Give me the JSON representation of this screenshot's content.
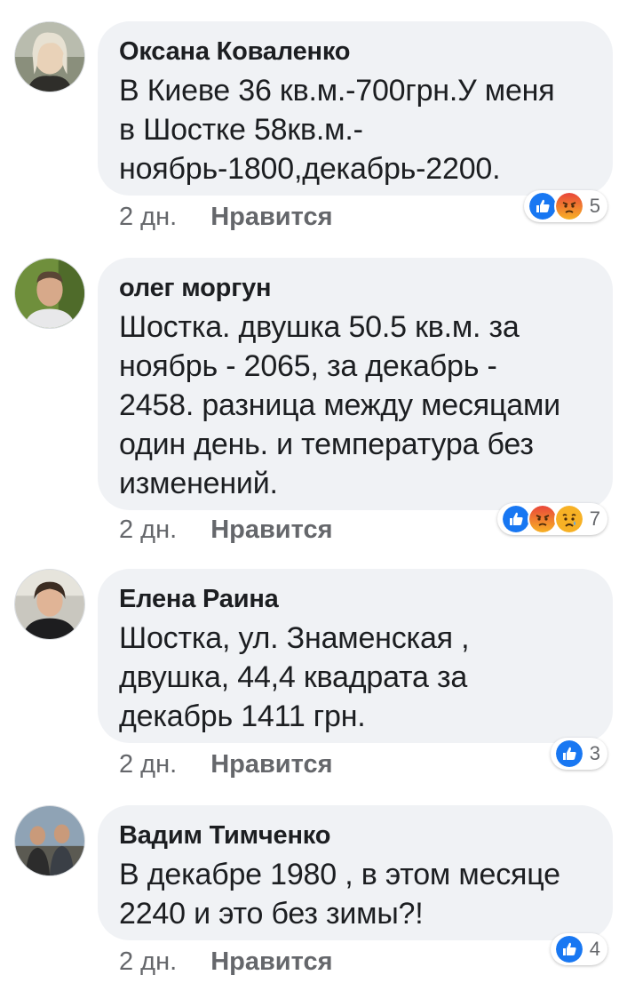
{
  "comments": [
    {
      "author": "Оксана Коваленко",
      "text_lines": [
        "В Киеве 36 кв.м.-700грн.У меня",
        "в Шостке 58кв.м.-",
        "ноябрь-1800,декабрь-2200."
      ],
      "time": "2 дн.",
      "like_label": "Нравится",
      "reactions": [
        "like-icon",
        "angry-icon"
      ],
      "reaction_count": "5"
    },
    {
      "author": "олег моргун",
      "text_lines": [
        "Шостка. двушка 50.5 кв.м. за",
        "ноябрь - 2065, за декабрь -",
        "2458. разница между месяцами",
        "один день. и температура без",
        "изменений."
      ],
      "time": "2 дн.",
      "like_label": "Нравится",
      "reactions": [
        "like-icon",
        "angry-icon",
        "sad-icon"
      ],
      "reaction_count": "7"
    },
    {
      "author": "Елена Раина",
      "text_lines": [
        "Шостка, ул. Знаменская ,",
        "двушка, 44,4 квадрата за",
        "декабрь 1411 грн."
      ],
      "time": "2 дн.",
      "like_label": "Нравится",
      "reactions": [
        "like-icon"
      ],
      "reaction_count": "3"
    },
    {
      "author": "Вадим Тимченко",
      "text_lines": [
        "В декабре 1980 , в этом месяце",
        "2240 и это без зимы?!"
      ],
      "time": "2 дн.",
      "like_label": "Нравится",
      "reactions": [
        "like-icon"
      ],
      "reaction_count": "4"
    }
  ],
  "colors": {
    "bubble": "#f0f2f5",
    "text": "#1c1e21",
    "meta": "#65676b",
    "like_blue": "#1877f2",
    "angry_orange": "#f5533d",
    "sad_yellow": "#f7b125"
  }
}
